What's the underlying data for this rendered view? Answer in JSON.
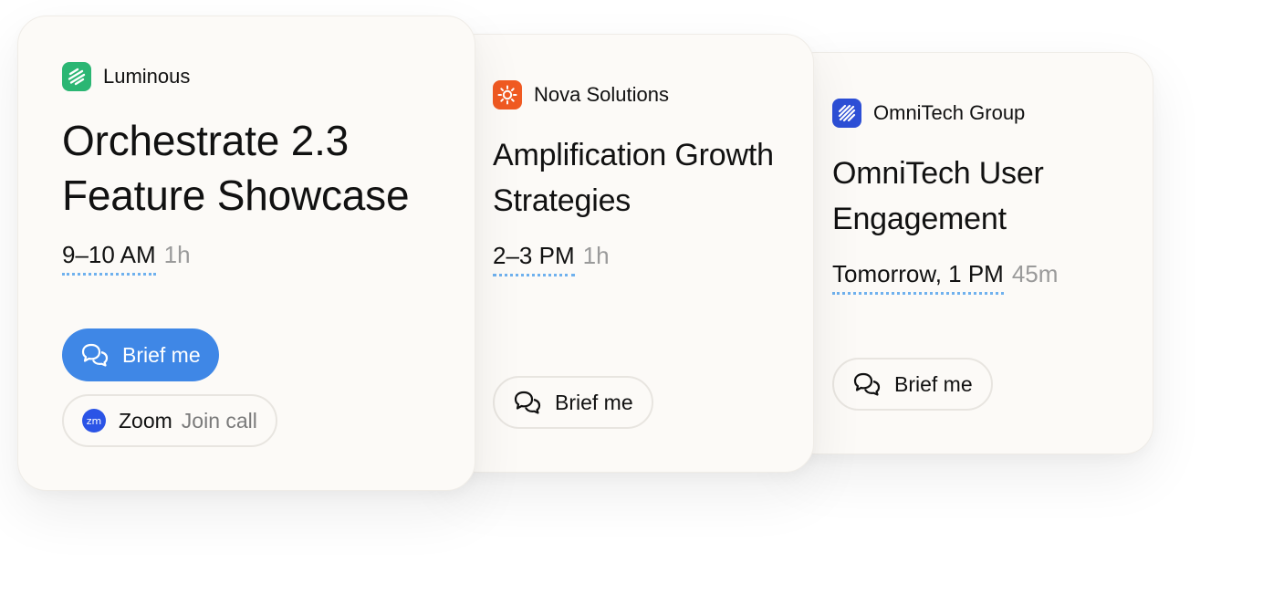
{
  "cards": [
    {
      "company": "Luminous",
      "title": "Orchestrate 2.3 Feature Showcase",
      "time": "9–10 AM",
      "duration": "1h",
      "brief_label": "Brief me",
      "call": {
        "app": "Zoom",
        "action": "Join call",
        "icon_text": "zm"
      },
      "logo_color": "#2bb673",
      "logo_icon": "luminous-logo-icon"
    },
    {
      "company": "Nova Solutions",
      "title": "Amplification Growth Strategies",
      "time": "2–3 PM",
      "duration": "1h",
      "brief_label": "Brief me",
      "logo_color": "#f05a22",
      "logo_icon": "nova-solutions-logo-icon"
    },
    {
      "company": "OmniTech Group",
      "title": "OmniTech User Engagement",
      "time": "Tomorrow, 1 PM",
      "duration": "45m",
      "brief_label": "Brief me",
      "logo_color": "#2d4fd6",
      "logo_icon": "omnitech-logo-icon"
    }
  ],
  "colors": {
    "primary_button": "#3f87e6",
    "card_background": "#fcfaf7",
    "time_underline": "#6fb1ee",
    "muted_text": "#9a9a9a"
  }
}
